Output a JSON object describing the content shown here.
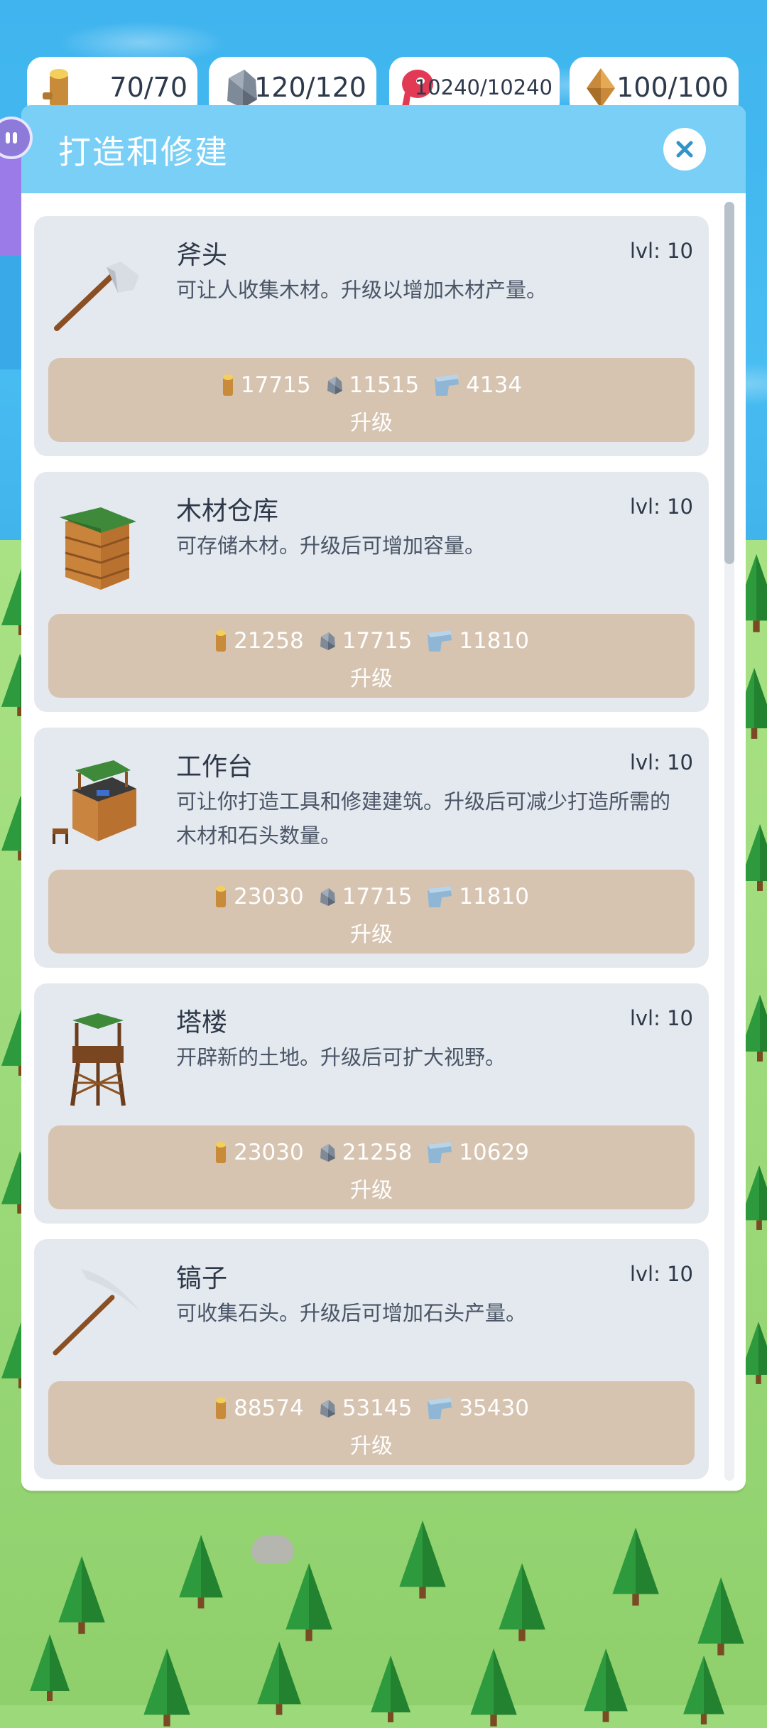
{
  "resources": {
    "wood": {
      "value": "70/70",
      "icon": "wood-log-icon"
    },
    "stone": {
      "value": "120/120",
      "icon": "stone-icon"
    },
    "meat": {
      "value": "10240/10240",
      "icon": "meat-icon"
    },
    "amber": {
      "value": "100/100",
      "icon": "amber-crystal-icon"
    }
  },
  "panel": {
    "title": "打造和修建",
    "close_icon": "close-icon",
    "items": [
      {
        "name": "斧头",
        "level": "lvl: 10",
        "desc": "可让人收集木材。升级以增加木材产量。",
        "icon": "axe-icon",
        "costs": {
          "wood": "17715",
          "stone": "11515",
          "metal": "4134"
        },
        "button": "升级"
      },
      {
        "name": "木材仓库",
        "level": "lvl: 10",
        "desc": "可存储木材。升级后可增加容量。",
        "icon": "wood-storage-icon",
        "costs": {
          "wood": "21258",
          "stone": "17715",
          "metal": "11810"
        },
        "button": "升级"
      },
      {
        "name": "工作台",
        "level": "lvl: 10",
        "desc": "可让你打造工具和修建建筑。升级后可减少打造所需的木材和石头数量。",
        "icon": "workbench-icon",
        "costs": {
          "wood": "23030",
          "stone": "17715",
          "metal": "11810"
        },
        "button": "升级"
      },
      {
        "name": "塔楼",
        "level": "lvl: 10",
        "desc": "开辟新的土地。升级后可扩大视野。",
        "icon": "watchtower-icon",
        "costs": {
          "wood": "23030",
          "stone": "21258",
          "metal": "10629"
        },
        "button": "升级"
      },
      {
        "name": "镐子",
        "level": "lvl: 10",
        "desc": "可收集石头。升级后可增加石头产量。",
        "icon": "pickaxe-icon",
        "costs": {
          "wood": "88574",
          "stone": "53145",
          "metal": "35430"
        },
        "button": "升级"
      }
    ]
  },
  "colors": {
    "header": "#79cff6",
    "card": "#e4e9ef",
    "upgrade_button": "#d6c4b0",
    "text": "#2e3848"
  }
}
